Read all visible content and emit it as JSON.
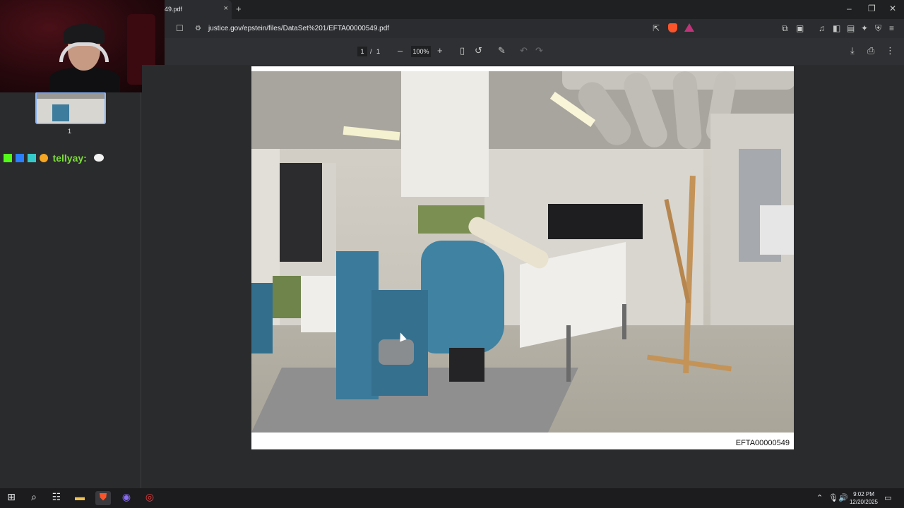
{
  "browser": {
    "tab_title": "49.pdf",
    "tab_close": "×",
    "new_tab": "+",
    "window_controls": {
      "minimize": "–",
      "restore": "❐",
      "close": "✕"
    },
    "url": "justice.gov/epstein/files/DataSet%201/EFTA00000549.pdf",
    "icons": [
      "bookmark-icon",
      "site-info-icon",
      "share-icon",
      "brave-shields-icon",
      "brave-rewards-icon",
      "extensions-icon",
      "media-icon",
      "sidebar-icon",
      "wallet-icon",
      "leo-ai-icon",
      "vpn-icon",
      "menu-icon"
    ]
  },
  "pdf_toolbar": {
    "page_current": "1",
    "page_separator": "/",
    "page_total": "1",
    "zoom_out": "–",
    "zoom_level": "100%",
    "zoom_in": "+",
    "download": "⤓",
    "print": "⎙",
    "more": "⋮"
  },
  "sidebar": {
    "thumbnail_label": "1"
  },
  "chat": {
    "username": "tellyay:",
    "badge_colors": [
      "#53fc18",
      "#2a7fff",
      "#35c9c9",
      "#f5a623"
    ]
  },
  "document": {
    "page_id": "EFTA00000549"
  },
  "taskbar": {
    "time": "9:02 PM",
    "date": "12/20/2025"
  }
}
